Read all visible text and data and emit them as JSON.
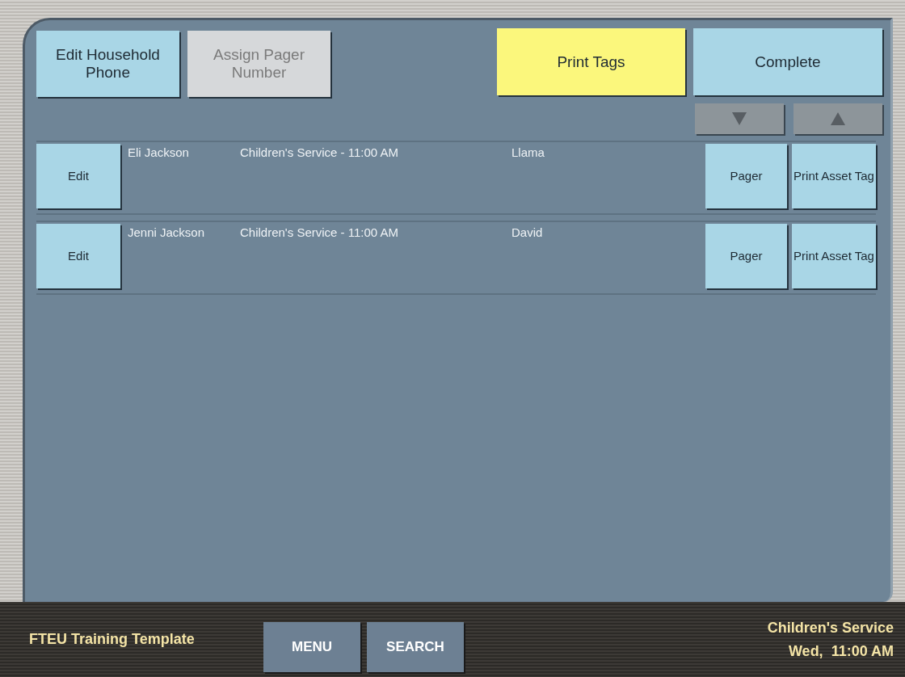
{
  "toolbar": [
    {
      "label": "Edit Household Phone",
      "disabled": false,
      "highlighted": false
    },
    {
      "label": "Assign Pager Number",
      "disabled": true,
      "highlighted": false
    },
    {
      "label": "Print Tags",
      "disabled": false,
      "highlighted": true
    },
    {
      "label": "Complete",
      "disabled": false,
      "highlighted": false
    }
  ],
  "rows": [
    {
      "edit": "Edit",
      "name": "Eli Jackson",
      "service": "Children's Service - 11:00 AM",
      "group": "Llama",
      "pager": "Pager",
      "print": "Print Asset Tag"
    },
    {
      "edit": "Edit",
      "name": "Jenni Jackson",
      "service": "Children's Service - 11:00 AM",
      "group": "David",
      "pager": "Pager",
      "print": "Print Asset Tag"
    }
  ],
  "footer": {
    "station": "FTEU Training Template",
    "buttons": [
      "MENU",
      "SEARCH"
    ],
    "service": "Children's Service",
    "time": "Wed,  11:00 AM"
  }
}
